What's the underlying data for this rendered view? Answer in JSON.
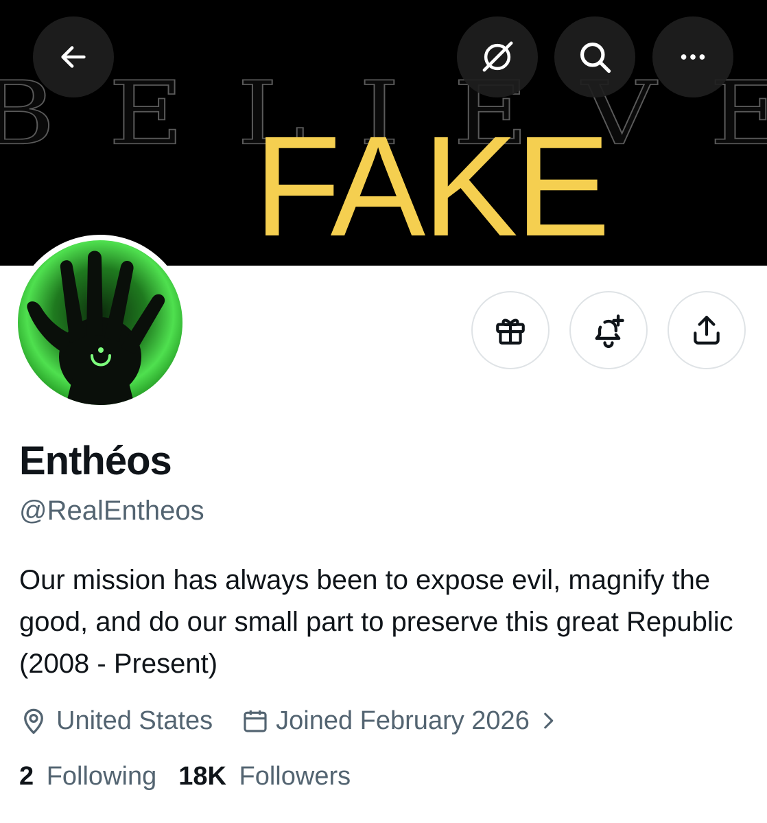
{
  "banner": {
    "background_text": "BELIEVE",
    "stamp_text": "FAKE",
    "stamp_color": "#f5cf50"
  },
  "nav": {
    "back_icon": "arrow-left-icon",
    "grok_icon": "grok-icon",
    "search_icon": "search-icon",
    "more_icon": "more-horizontal-icon"
  },
  "profile": {
    "display_name": "Enthéos",
    "handle": "@RealEntheos",
    "bio": "Our mission has always been to expose evil, magnify the good, and do our small part to preserve this great Republic (2008 - Present)",
    "location": "United States",
    "joined": "Joined February 2026",
    "following_count": "2",
    "following_label": "Following",
    "followers_count": "18K",
    "followers_label": "Followers"
  },
  "actions": {
    "gift_icon": "gift-icon",
    "notify_icon": "bell-plus-icon",
    "share_icon": "share-icon"
  },
  "colors": {
    "text_primary": "#0f1419",
    "text_secondary": "#536471",
    "border": "#dfe3e6"
  }
}
